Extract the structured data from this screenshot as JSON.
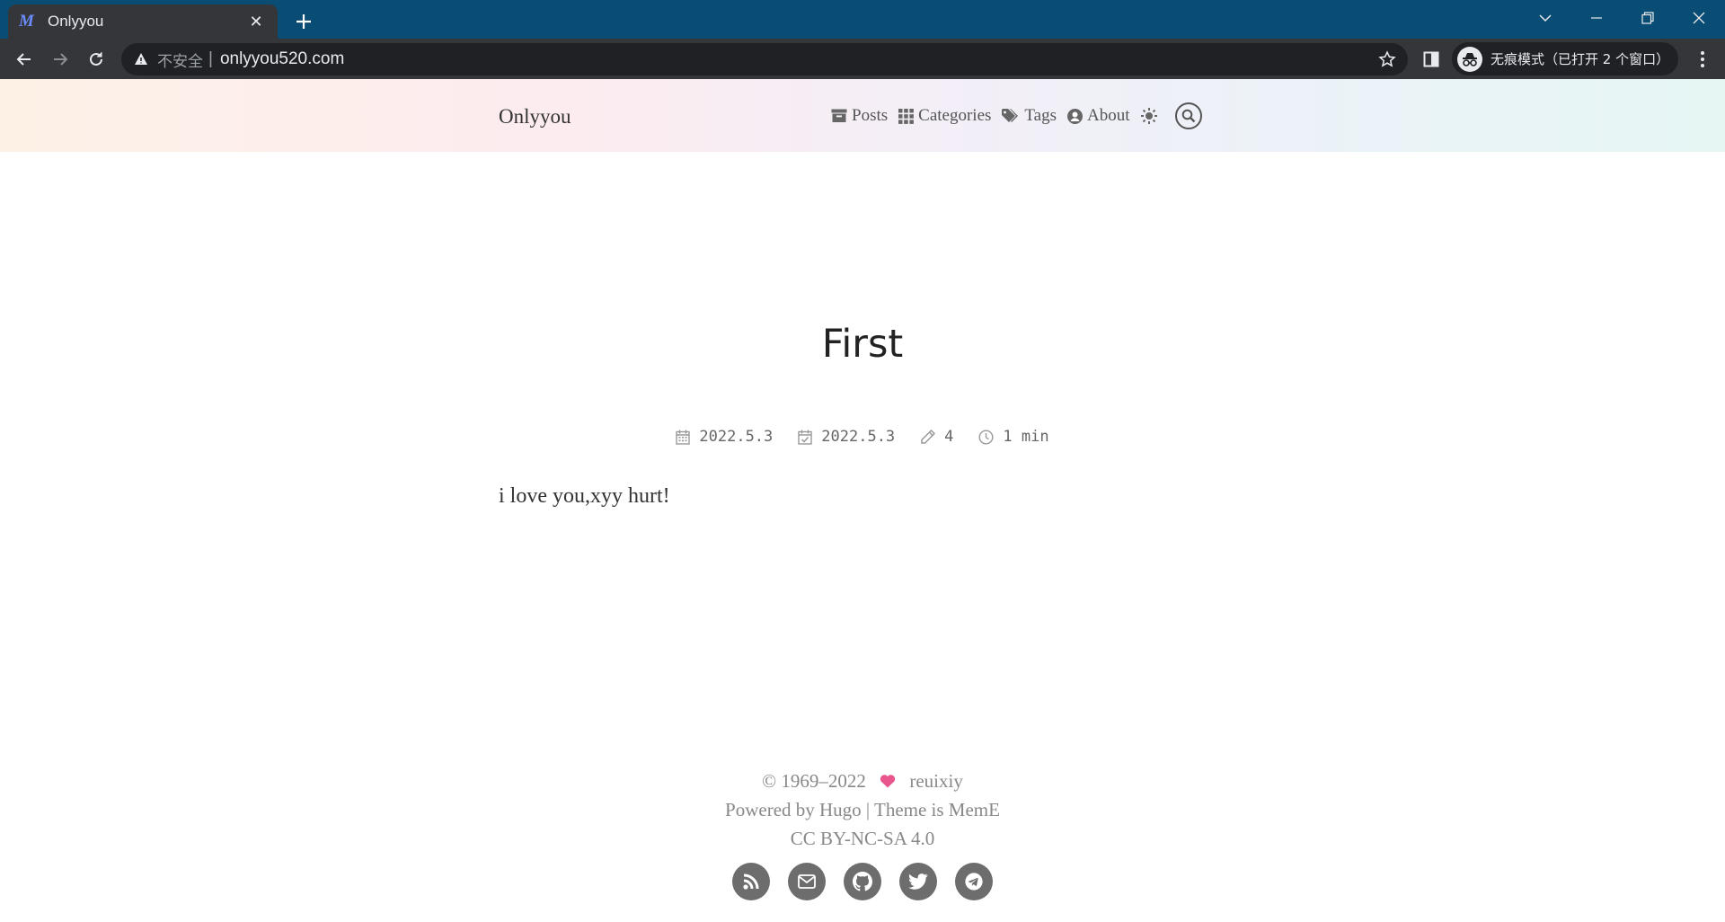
{
  "browser": {
    "tab_title": "Onlyyou",
    "tab_favicon": "M",
    "security_label": "不安全",
    "url": "onlyyou520.com",
    "incognito_label": "无痕模式（已打开 2 个窗口）"
  },
  "site": {
    "title": "Onlyyou",
    "nav": [
      {
        "label": "Posts",
        "icon": "archive-icon"
      },
      {
        "label": "Categories",
        "icon": "grid-icon"
      },
      {
        "label": "Tags",
        "icon": "tags-icon"
      },
      {
        "label": "About",
        "icon": "user-circle-icon"
      }
    ]
  },
  "post": {
    "title": "First",
    "published": "2022.5.3",
    "updated": "2022.5.3",
    "word_count": "4",
    "reading_time": "1 min",
    "body": "i love you,xyy hurt!"
  },
  "footer": {
    "copyright": "© 1969–2022",
    "author": "reuixiy",
    "powered_by": "Powered by Hugo | Theme is MemE",
    "license": "CC BY-NC-SA 4.0",
    "heart_color": "#e8568d",
    "socials": [
      "rss-icon",
      "email-icon",
      "github-icon",
      "twitter-icon",
      "telegram-icon"
    ]
  }
}
